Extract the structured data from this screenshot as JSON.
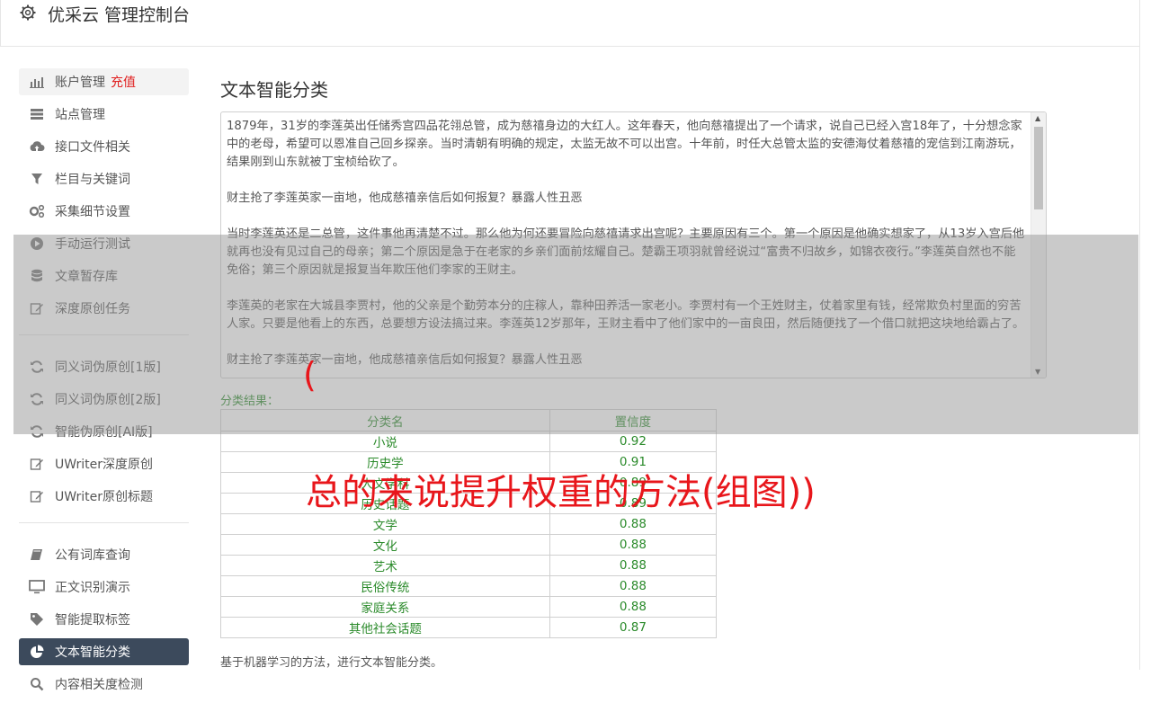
{
  "app": {
    "title": "优采云 管理控制台",
    "icon": "gear-icon"
  },
  "sidebar": {
    "groups": [
      [
        {
          "label": "账户管理",
          "badge": "充值",
          "icon": "bar-chart-icon",
          "state": "soft"
        },
        {
          "label": "站点管理",
          "icon": "server-icon"
        },
        {
          "label": "接口文件相关",
          "icon": "cloud-upload-icon"
        },
        {
          "label": "栏目与关键词",
          "icon": "filter-icon"
        },
        {
          "label": "采集细节设置",
          "icon": "cogs-icon"
        },
        {
          "label": "手动运行测试",
          "icon": "play-circle-icon"
        },
        {
          "label": "文章暂存库",
          "icon": "database-icon"
        },
        {
          "label": "深度原创任务",
          "icon": "edit-icon"
        }
      ],
      [
        {
          "label": "同义词伪原创[1版]",
          "icon": "refresh-icon"
        },
        {
          "label": "同义词伪原创[2版]",
          "icon": "refresh-icon"
        },
        {
          "label": "智能伪原创[AI版]",
          "icon": "refresh-icon"
        },
        {
          "label": "UWriter深度原创",
          "icon": "edit-icon"
        },
        {
          "label": "UWriter原创标题",
          "icon": "edit-icon"
        }
      ],
      [
        {
          "label": "公有词库查询",
          "icon": "book-icon"
        },
        {
          "label": "正文识别演示",
          "icon": "monitor-icon"
        },
        {
          "label": "智能提取标签",
          "icon": "tag-icon"
        },
        {
          "label": "文本智能分类",
          "icon": "pie-chart-icon",
          "state": "active"
        },
        {
          "label": "内容相关度检测",
          "icon": "search-icon"
        }
      ]
    ]
  },
  "main": {
    "title": "文本智能分类",
    "text_paragraphs": [
      "1879年，31岁的李莲英出任储秀宫四品花翎总管，成为慈禧身边的大红人。这年春天，他向慈禧提出了一个请求，说自己已经入宫18年了，十分想念家中的老母，希望可以恩准自己回乡探亲。当时清朝有明确的规定，太监无故不可以出宫。十年前，时任大总管太监的安德海仗着慈禧的宠信到江南游玩，结果刚到山东就被丁宝桢给砍了。",
      "财主抢了李莲英家一亩地，他成慈禧亲信后如何报复？暴露人性丑恶",
      "当时李莲英还是二总管，这件事他再清楚不过。那么他为何还要冒险向慈禧请求出宫呢？主要原因有三个。第一个原因是他确实想家了，从13岁入宫后他就再也没有见过自己的母亲；第二个原因是急于在老家的乡亲们面前炫耀自己。楚霸王项羽就曾经说过“富贵不归故乡，如锦衣夜行。”李莲英自然也不能免俗；第三个原因就是报复当年欺压他们李家的王财主。",
      "李莲英的老家在大城县李贾村，他的父亲是个勤劳本分的庄稼人，靠种田养活一家老小。李贾村有一个王姓财主，仗着家里有钱，经常欺负村里面的穷苦人家。只要是他看上的东西，总要想方设法搞过来。李莲英12岁那年，王财主看中了他们家中的一亩良田，然后随便找了一个借口就把这块地给霸占了。",
      "财主抢了李莲英家一亩地，他成慈禧亲信后如何报复？暴露人性丑恶"
    ],
    "result_label": "分类结果：",
    "table": {
      "headers": [
        "分类名",
        "置信度"
      ],
      "rows": [
        [
          "小说",
          "0.92"
        ],
        [
          "历史学",
          "0.91"
        ],
        [
          "人文学科",
          "0.89"
        ],
        [
          "历史话题",
          "0.89"
        ],
        [
          "文学",
          "0.88"
        ],
        [
          "文化",
          "0.88"
        ],
        [
          "艺术",
          "0.88"
        ],
        [
          "民俗传统",
          "0.88"
        ],
        [
          "家庭关系",
          "0.88"
        ],
        [
          "其他社会话题",
          "0.87"
        ]
      ]
    },
    "footnote": "基于机器学习的方法，进行文本智能分类。"
  },
  "overlay": {
    "paren": "(",
    "headline": "总的来说提升权重的方法(组图))",
    "color": "#e8161b"
  }
}
